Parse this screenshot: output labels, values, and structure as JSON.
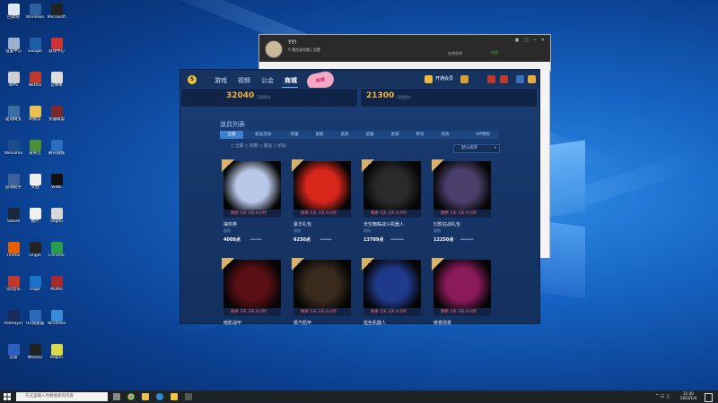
{
  "desktop_icons": [
    {
      "label": "回收站",
      "color": "#dfe8f2"
    },
    {
      "label": "Windows",
      "color": "#2d5fa0"
    },
    {
      "label": "Microsoft",
      "color": "#222222"
    },
    {
      "label": "设置中心",
      "color": "#9ab0cf"
    },
    {
      "label": "Google",
      "color": "#1f5ea8"
    },
    {
      "label": "游戏中心",
      "color": "#cc3333"
    },
    {
      "label": "WPS",
      "color": "#d0d0d0"
    },
    {
      "label": "Netflix",
      "color": "#c0392b"
    },
    {
      "label": "记事本",
      "color": "#dddddd"
    },
    {
      "label": "驱动精灵",
      "color": "#3a6ea5"
    },
    {
      "label": "网易云",
      "color": "#e8c050"
    },
    {
      "label": "英雄联盟",
      "color": "#7a2a2a"
    },
    {
      "label": "WeGame",
      "color": "#1b4c8a"
    },
    {
      "label": "爱奇艺",
      "color": "#4a8f3a"
    },
    {
      "label": "腾讯视频",
      "color": "#2b6cbf"
    },
    {
      "label": "游戏助手",
      "color": "#3a5f9a"
    },
    {
      "label": "文档",
      "color": "#eeeeee"
    },
    {
      "label": "WWE",
      "color": "#111111"
    },
    {
      "label": "Steam",
      "color": "#1b2838"
    },
    {
      "label": "图片",
      "color": "#f2f2f2"
    },
    {
      "label": "Sogou",
      "color": "#d8d8d8"
    },
    {
      "label": "Firefox",
      "color": "#e66000"
    },
    {
      "label": "Origin",
      "color": "#232323"
    },
    {
      "label": "Chrome",
      "color": "#2a9d4a"
    },
    {
      "label": "QQ音乐",
      "color": "#c0392b"
    },
    {
      "label": "Edge",
      "color": "#1a73c8"
    },
    {
      "label": "MuMu",
      "color": "#a52a2a"
    },
    {
      "label": "PotPlayer",
      "color": "#1a2a5a"
    },
    {
      "label": "UU加速器",
      "color": "#2a6ab8"
    },
    {
      "label": "Windows",
      "color": "#3b8ad8"
    },
    {
      "label": "迅雷",
      "color": "#2b5fc0"
    },
    {
      "label": "腾讯QQ",
      "color": "#222222"
    },
    {
      "label": "Kugou",
      "color": "#d8d84a"
    }
  ],
  "chat": {
    "name": "YY!",
    "subtitle": "V 我在说话哦 | 设置",
    "status": "在线空间",
    "right_text": "在线"
  },
  "shop": {
    "logo": "S",
    "nav": [
      "游戏",
      "视频",
      "公会",
      "商城"
    ],
    "badge": "商城",
    "user_label": "开通会员",
    "summary": [
      {
        "value": "32040",
        "note": "可用积分"
      },
      {
        "value": "21300",
        "note": "可用积分"
      }
    ],
    "section_title": "道具列表",
    "categories": [
      "全部",
      "新品活动",
      "英雄",
      "皮肤",
      "道具",
      "武器",
      "坐骑",
      "称号",
      "其他",
      "VIP特权"
    ],
    "filters": "○ 全部  ○ 热销  ○ 新品  ○ 折扣",
    "sort": "默认排序",
    "items": [
      {
        "name": "抽奖券",
        "tag": "限购",
        "price": "4009点",
        "old": "5000点",
        "timer": "剩余 5天 3天 6小时",
        "color": "#b9c7e8"
      },
      {
        "name": "豪华礼包",
        "tag": "限购",
        "price": "6250点",
        "old": "8000点",
        "timer": "剩余 5天 3天 6小时",
        "color": "#d8261a"
      },
      {
        "name": "天空蜘蛛战斗机器人",
        "tag": "限购",
        "price": "13709点",
        "old": "16000点",
        "timer": "剩余 5天 3天 6小时",
        "color": "#2a2a2a"
      },
      {
        "name": "幻影狂战礼包",
        "tag": "限购",
        "price": "12250点",
        "old": "15000点",
        "timer": "剩余 5天 3天 6小时",
        "color": "#4a3f6a"
      },
      {
        "name": "暗影战甲",
        "tag": "",
        "price": "",
        "old": "",
        "timer": "剩余 5天 3天 6小时",
        "color": "#5a0f14"
      },
      {
        "name": "蒸汽机甲",
        "tag": "",
        "price": "",
        "old": "",
        "timer": "剩余 5天 3天 6小时",
        "color": "#3a2a1e"
      },
      {
        "name": "蓝色机器人",
        "tag": "",
        "price": "",
        "old": "",
        "timer": "剩余 5天 3天 6小时",
        "color": "#1f3a8a"
      },
      {
        "name": "荣誉勋章",
        "tag": "",
        "price": "",
        "old": "",
        "timer": "剩余 5天 3天 6小时",
        "color": "#8a1a5a"
      }
    ]
  },
  "taskbar": {
    "search": "在这里输入你要搜索的内容",
    "time": "21:20",
    "date": "2022/1/4"
  }
}
